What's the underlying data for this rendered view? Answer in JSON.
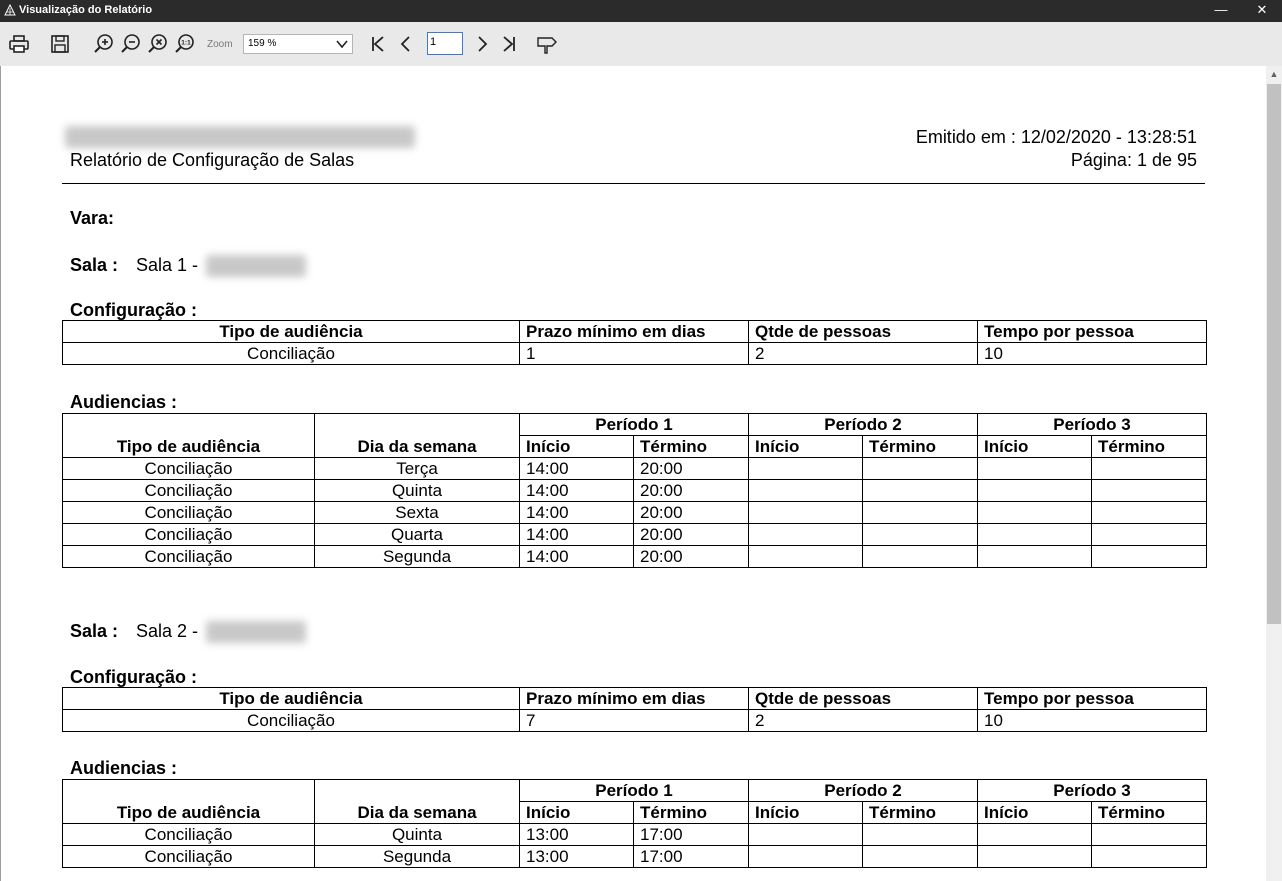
{
  "window": {
    "title": "Visualização do Relatório",
    "minimize": "—",
    "close": "✕"
  },
  "toolbar": {
    "zoom_label": "Zoom",
    "zoom_value": "159 %",
    "page_number": "1",
    "icons": [
      "print-icon",
      "save-icon",
      "zoom-in-icon",
      "zoom-out-icon",
      "zoom-reset-icon",
      "zoom-page-icon",
      "first-page-icon",
      "prev-page-icon",
      "next-page-icon",
      "last-page-icon",
      "hand-pointer-icon"
    ]
  },
  "report": {
    "title": "Relatório de Configuração de Salas",
    "emitted": "Emitido em : 12/02/2020 - 13:28:51",
    "page": "Página: 1 de 95",
    "vara_label": "Vara:",
    "sala_label": "Sala :",
    "config_label": "Configuração :",
    "audiencias_label": "Audiencias :",
    "config_headers": [
      "Tipo de audiência",
      "Prazo mínimo em dias",
      "Qtde de pessoas",
      "Tempo por pessoa"
    ],
    "aud_headers": {
      "tipo": "Tipo de audiência",
      "dia": "Dia da semana",
      "periodos": [
        "Período 1",
        "Período 2",
        "Período 3"
      ],
      "inicio": "Início",
      "termino": "Término"
    },
    "salas": [
      {
        "name": "Sala 1 -",
        "config": [
          "Conciliação",
          "1",
          "2",
          "10"
        ],
        "rows": [
          [
            "Conciliação",
            "Terça",
            "14:00",
            "20:00"
          ],
          [
            "Conciliação",
            "Quinta",
            "14:00",
            "20:00"
          ],
          [
            "Conciliação",
            "Sexta",
            "14:00",
            "20:00"
          ],
          [
            "Conciliação",
            "Quarta",
            "14:00",
            "20:00"
          ],
          [
            "Conciliação",
            "Segunda",
            "14:00",
            "20:00"
          ]
        ]
      },
      {
        "name": "Sala 2 -",
        "config": [
          "Conciliação",
          "7",
          "2",
          "10"
        ],
        "rows": [
          [
            "Conciliação",
            "Quinta",
            "13:00",
            "17:00"
          ],
          [
            "Conciliação",
            "Segunda",
            "13:00",
            "17:00"
          ]
        ]
      }
    ]
  }
}
